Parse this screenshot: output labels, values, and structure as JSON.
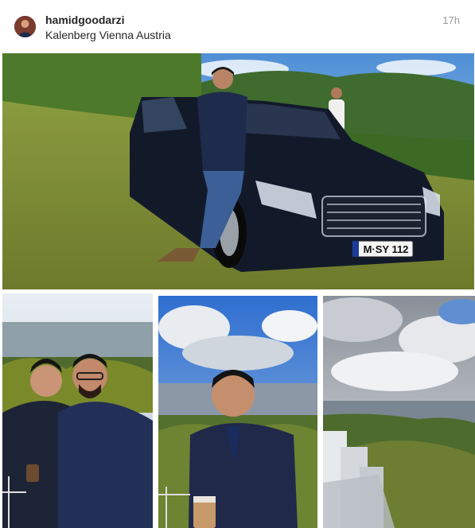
{
  "post": {
    "username": "hamidgoodarzi",
    "location": "Kalenberg Vienna Austria",
    "timestamp": "17h"
  },
  "photos": {
    "main": {
      "plate": "M·SY 112"
    }
  },
  "colors": {
    "text": "#262626",
    "muted": "#999999",
    "divider": "#efefef"
  }
}
